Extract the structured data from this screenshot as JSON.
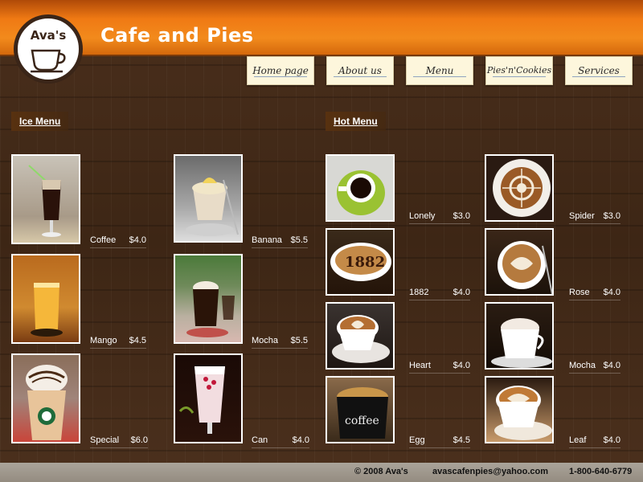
{
  "header": {
    "logo_text": "Ava's",
    "site_title": "Cafe and Pies"
  },
  "nav": [
    {
      "label": "Home page"
    },
    {
      "label": "About us"
    },
    {
      "label": "Menu"
    },
    {
      "label": "Pies'n'Cookies"
    },
    {
      "label": "Services"
    }
  ],
  "ice_menu": {
    "title": "Ice Menu",
    "items": [
      {
        "name": "Coffee",
        "price": "$4.0"
      },
      {
        "name": "Mango",
        "price": "$4.5"
      },
      {
        "name": "Special",
        "price": "$6.0"
      },
      {
        "name": "Banana",
        "price": "$5.5"
      },
      {
        "name": "Mocha",
        "price": "$5.5"
      },
      {
        "name": "Can",
        "price": "$4.0"
      }
    ]
  },
  "hot_menu": {
    "title": "Hot Menu",
    "items": [
      {
        "name": "Lonely",
        "price": "$3.0"
      },
      {
        "name": "1882",
        "price": "$4.0"
      },
      {
        "name": "Heart",
        "price": "$4.0"
      },
      {
        "name": "Egg",
        "price": "$4.5"
      },
      {
        "name": "Spider",
        "price": "$3.0"
      },
      {
        "name": "Rose",
        "price": "$4.0"
      },
      {
        "name": "Mocha",
        "price": "$4.0"
      },
      {
        "name": "Leaf",
        "price": "$4.0"
      }
    ]
  },
  "footer": {
    "copyright": "© 2008  Ava's",
    "email": "avascafenpies@yahoo.com",
    "phone": "1-800-640-6779"
  },
  "thumb_text": {
    "cup_1882": "1882",
    "cup_coffee": "coffee"
  },
  "colors": {
    "header_orange": "#f07a14",
    "wood_brown": "#3d2615",
    "nav_button_bg": "#fdf6dc",
    "footer_gray": "#9c958a"
  }
}
